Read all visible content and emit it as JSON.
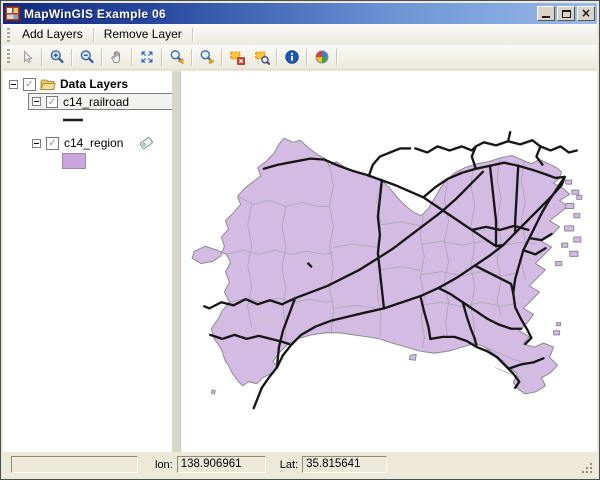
{
  "window": {
    "title": "MapWinGIS Example 06"
  },
  "menu": {
    "items": [
      {
        "label": "Add Layers"
      },
      {
        "label": "Remove Layer"
      }
    ]
  },
  "toolbar": {
    "buttons": [
      "pointer",
      "zoom-in",
      "zoom-out",
      "pan",
      "zoom-full-extent",
      "zoom-previous",
      "zoom-next",
      "clear-selection",
      "zoom-to-selection",
      "identify",
      "symbology"
    ]
  },
  "layer_tree": {
    "root": {
      "label": "Data Layers",
      "checked": true,
      "expanded": true
    },
    "layers": [
      {
        "label": "c14_railroad",
        "checked": true,
        "selected": true,
        "legend_type": "line",
        "legend_color": "#1a1a1a"
      },
      {
        "label": "c14_region",
        "checked": true,
        "selected": false,
        "legend_type": "fill",
        "legend_color": "#c9a7dc"
      }
    ]
  },
  "status_bar": {
    "lon_label": "lon:",
    "lon_value": "138.906961",
    "lat_label": "Lat:",
    "lat_value": "35.815641"
  },
  "map": {
    "region_fill": "#d4bbe4",
    "region_border": "#8f8a96",
    "boundary_color": "#a7a3ac",
    "railroad_color": "#161616",
    "background": "#ffffff"
  },
  "icons": {
    "check": "✓",
    "close": "×"
  }
}
